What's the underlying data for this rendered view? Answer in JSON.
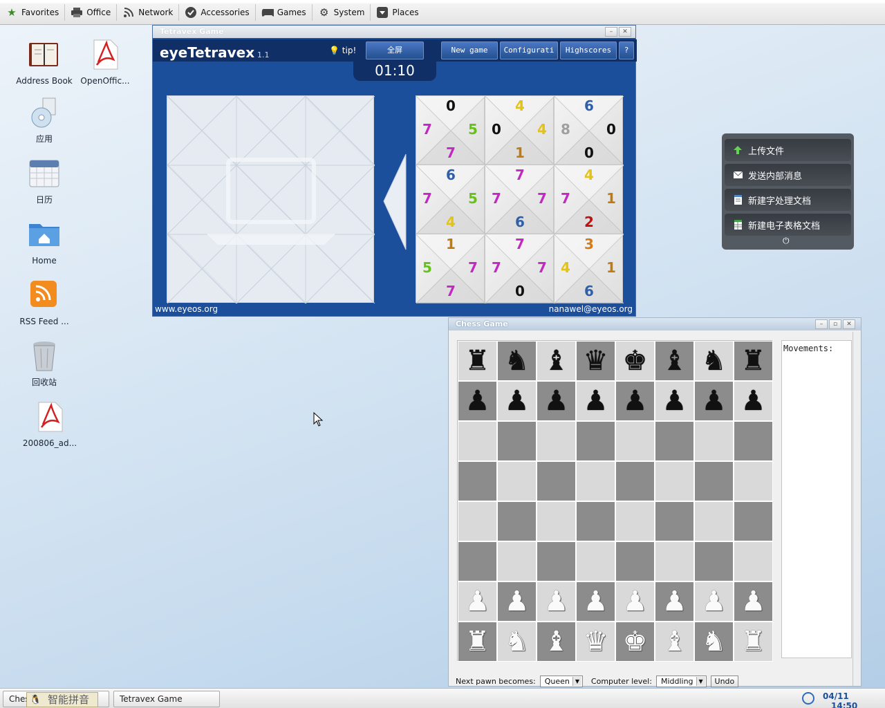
{
  "topbar": {
    "items": [
      {
        "label": "Favorites",
        "icon": "star-icon"
      },
      {
        "label": "Office",
        "icon": "printer-icon"
      },
      {
        "label": "Network",
        "icon": "rss-icon"
      },
      {
        "label": "Accessories",
        "icon": "check-icon"
      },
      {
        "label": "Games",
        "icon": "gamepad-icon"
      },
      {
        "label": "System",
        "icon": "gear-icon"
      },
      {
        "label": "Places",
        "icon": "download-box-icon"
      }
    ]
  },
  "desktop": {
    "icons": [
      {
        "label": "Address Book",
        "icon": "address-book-icon"
      },
      {
        "label": "OpenOffic...",
        "icon": "pdf-icon"
      },
      {
        "label": "应用",
        "icon": "cd-icon"
      },
      {
        "label": "日历",
        "icon": "calendar-icon"
      },
      {
        "label": "Home",
        "icon": "home-folder-icon"
      },
      {
        "label": "RSS Feed ...",
        "icon": "rss-feed-icon"
      },
      {
        "label": "回收站",
        "icon": "trash-icon"
      },
      {
        "label": "200806_ad...",
        "icon": "pdf-icon"
      }
    ]
  },
  "tetravex": {
    "window_title": "Tetravex Game",
    "brand": "eyeTetravex",
    "version": "1.1",
    "tip": "tip!",
    "buttons": {
      "fullscreen": "全屏",
      "new_game": "New game",
      "config": "Configurati",
      "highscores": "Highscores",
      "help": "?"
    },
    "timer": "01:10",
    "footer_left": "www.eyeos.org",
    "footer_right": "nanawel@eyeos.org",
    "tiles": [
      {
        "t": "0",
        "r": "5",
        "b": "7",
        "l": "7"
      },
      {
        "t": "4",
        "r": "4",
        "b": "1",
        "l": "0"
      },
      {
        "t": "6",
        "r": "0",
        "b": "0",
        "l": "8"
      },
      {
        "t": "6",
        "r": "5",
        "b": "4",
        "l": "7"
      },
      {
        "t": "7",
        "r": "7",
        "b": "6",
        "l": "7"
      },
      {
        "t": "4",
        "r": "1",
        "b": "2",
        "l": "7"
      },
      {
        "t": "1",
        "r": "7",
        "b": "7",
        "l": "5"
      },
      {
        "t": "7",
        "r": "7",
        "b": "0",
        "l": "7"
      },
      {
        "t": "3",
        "r": "1",
        "b": "6",
        "l": "4"
      }
    ],
    "digit_colors": {
      "0": "#111111",
      "1": "#c07a12",
      "2": "#c01010",
      "3": "#d67a14",
      "4": "#e2c31a",
      "5": "#66c21a",
      "6": "#2e5fa8",
      "7": "#c428c4",
      "8": "#a0a0a0"
    }
  },
  "widget": {
    "items": [
      {
        "label": "上传文件",
        "icon": "upload-arrow-icon"
      },
      {
        "label": "发送内部消息",
        "icon": "envelope-icon"
      },
      {
        "label": "新建字处理文档",
        "icon": "document-icon"
      },
      {
        "label": "新建电子表格文档",
        "icon": "spreadsheet-icon"
      }
    ],
    "power": "⏻"
  },
  "chess": {
    "window_title": "Chess Game",
    "movements_label": "Movements:",
    "next_pawn_label": "Next pawn becomes:",
    "next_pawn_value": "Queen",
    "level_label": "Computer level:",
    "level_value": "Middling",
    "undo": "Undo",
    "rows": [
      [
        "r",
        "n",
        "b",
        "q",
        "k",
        "b",
        "n",
        "r"
      ],
      [
        "p",
        "p",
        "p",
        "p",
        "p",
        "p",
        "p",
        "p"
      ],
      [
        "",
        "",
        "",
        "",
        "",
        "",
        "",
        ""
      ],
      [
        "",
        "",
        "",
        "",
        "",
        "",
        "",
        ""
      ],
      [
        "",
        "",
        "",
        "",
        "",
        "",
        "",
        ""
      ],
      [
        "",
        "",
        "",
        "",
        "",
        "",
        "",
        ""
      ],
      [
        "P",
        "P",
        "P",
        "P",
        "P",
        "P",
        "P",
        "P"
      ],
      [
        "R",
        "N",
        "B",
        "Q",
        "K",
        "B",
        "N",
        "R"
      ]
    ]
  },
  "taskbar": {
    "tasks": [
      "Ches",
      "Tetravex Game"
    ],
    "ime": "智能拼音",
    "date": "04/11",
    "time": "14:50"
  }
}
